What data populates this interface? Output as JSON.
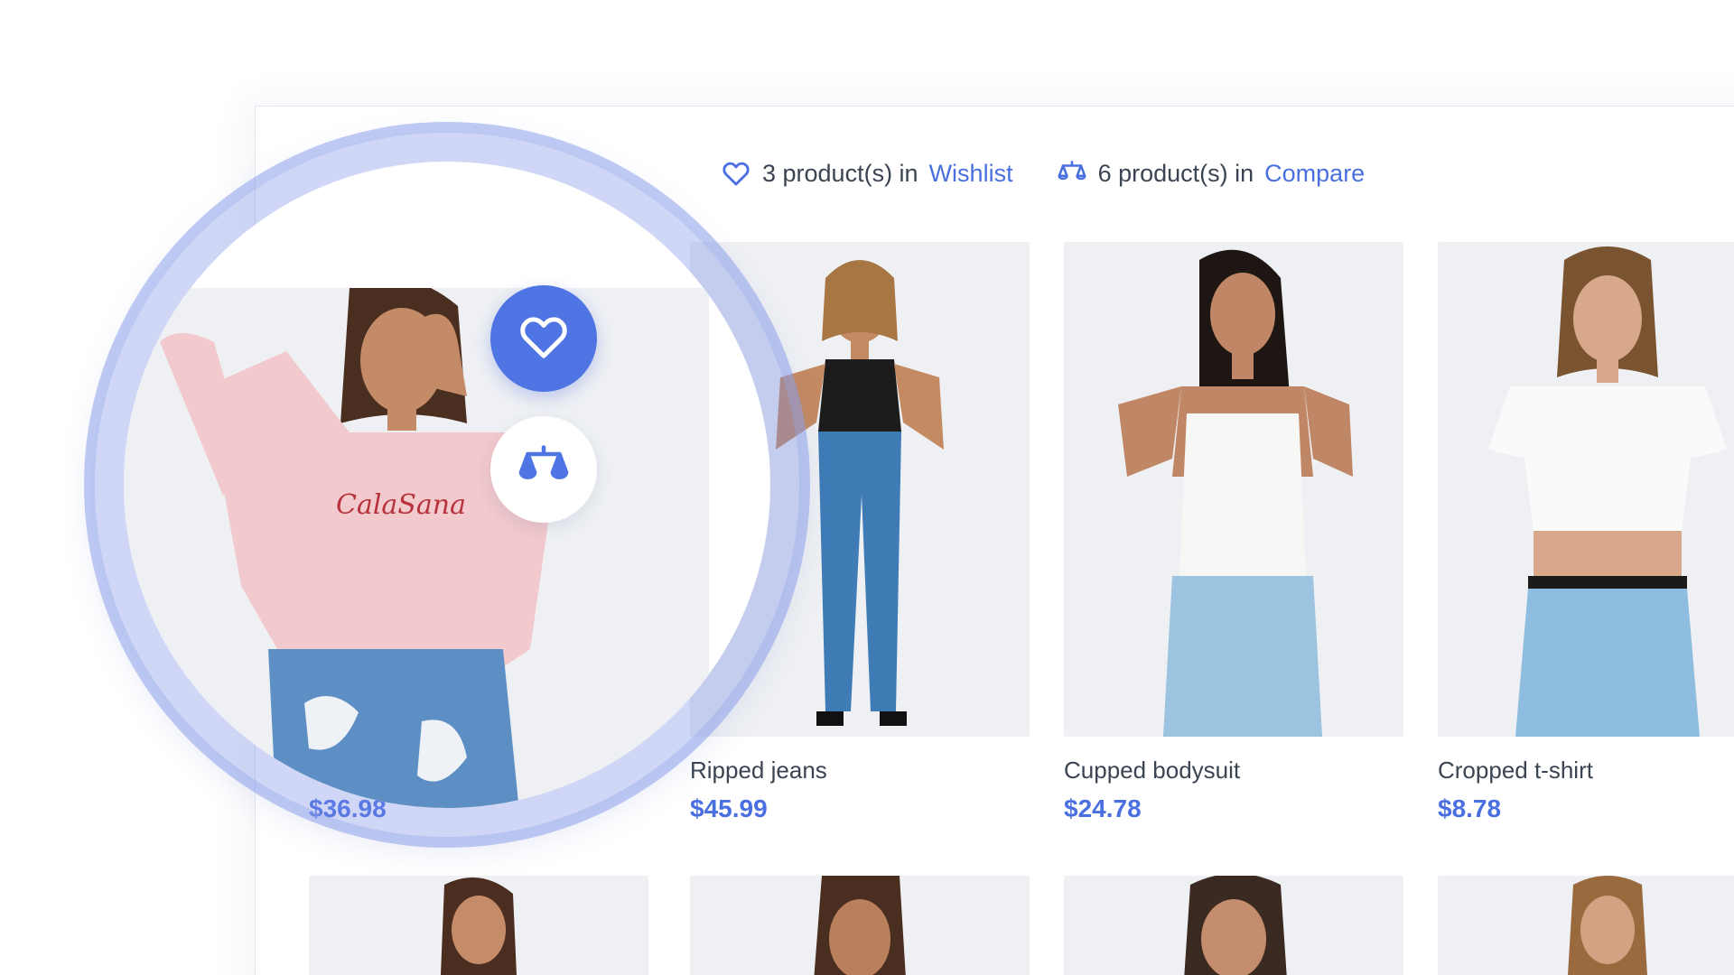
{
  "summary": {
    "wishlist": {
      "count_text": "3 product(s) in",
      "link": "Wishlist",
      "icon": "heart-outline-icon"
    },
    "compare": {
      "count_text": "6 product(s) in",
      "link": "Compare",
      "icon": "scales-icon"
    }
  },
  "products": [
    {
      "name": "",
      "price": "$36.98",
      "top_color": "#f2c9cc",
      "bottom_color": "#5d8fc4",
      "highlighted": true
    },
    {
      "name": "Ripped jeans",
      "price": "$45.99",
      "top_color": "#1c1c1c",
      "bottom_color": "#3f7bb5"
    },
    {
      "name": "Cupped bodysuit",
      "price": "$24.78",
      "top_color": "#f6f6f4",
      "bottom_color": "#9cc3df"
    },
    {
      "name": "Cropped t-shirt",
      "price": "$8.78",
      "top_color": "#fafafa",
      "bottom_color": "#8fbde0"
    }
  ],
  "second_row": [
    {
      "top_color": "#1f1f1f"
    },
    {
      "top_color": "#f0f0f0"
    },
    {
      "top_color": "#efefef"
    },
    {
      "top_color": "#1f1f1f"
    }
  ],
  "magnifier": {
    "wishlist_button_icon": "heart-icon",
    "compare_button_icon": "scales-icon"
  },
  "colors": {
    "accent": "#4f74e3",
    "link": "#4a6fe0",
    "text": "#3b4452",
    "ring": "#8ca0eb"
  }
}
